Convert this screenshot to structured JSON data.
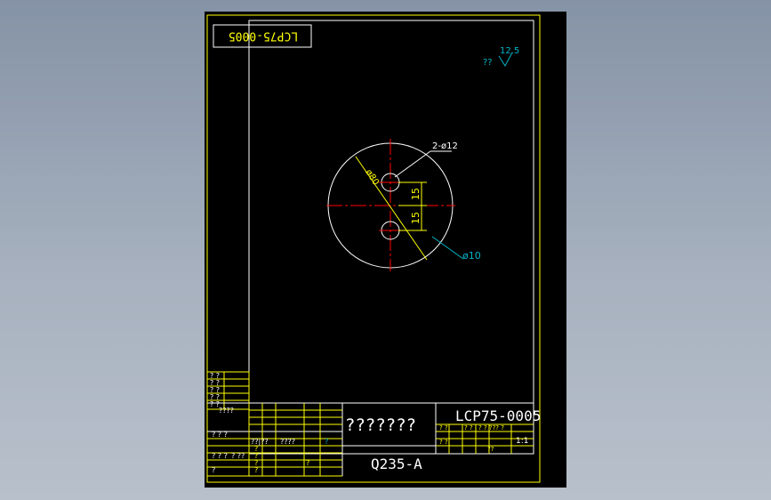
{
  "colors": {
    "background": "#000000",
    "frame": "#ffff00",
    "inner_frame": "#ffffff",
    "centerline": "#ff0000",
    "dimension": "#00b4c8",
    "table_text": "#00ff00"
  },
  "drawing": {
    "code_mirrored": "LCP75-0005",
    "roughness_prefix": "??",
    "roughness_value": "12.5",
    "hole_label": "2-ø12",
    "diameter_outer": "ø80",
    "diameter_shaft": "ø10",
    "dim_upper": "15",
    "dim_lower": "15"
  },
  "title_block": {
    "part_name": "???????",
    "drawing_number": "LCP75-0005",
    "material": "Q235-A",
    "scale": "1:1",
    "side_table": [
      "? ?",
      "? ?",
      "? ?",
      "? ?",
      "? ?"
    ],
    "side_bottom": "????",
    "left_rows": [
      "? ? ?",
      "? ? ?",
      "? ??",
      "?"
    ],
    "mid_labels": [
      "??|??",
      "????",
      "?",
      "?",
      "?",
      "?",
      "?",
      "?"
    ],
    "right_small": [
      "? ?",
      "? ?",
      "? ?",
      "? ? ??? ?",
      "??"
    ]
  }
}
